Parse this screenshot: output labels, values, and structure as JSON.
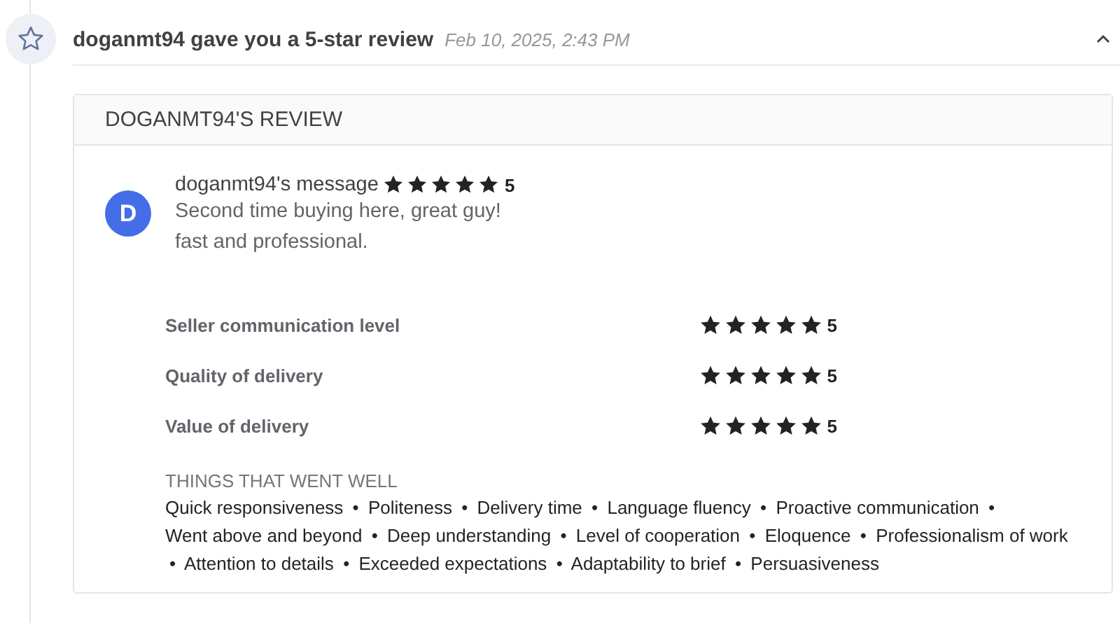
{
  "notification": {
    "title": "doganmt94 gave you a 5-star review",
    "date": "Feb 10, 2025, 2:43 PM",
    "expanded": true
  },
  "review": {
    "heading": "DOGANMT94'S REVIEW",
    "avatar_letter": "D",
    "author": "doganmt94's message",
    "stars": 5,
    "rating": "5",
    "message": [
      "Second time buying here, great guy!",
      "fast and professional."
    ],
    "ratings": [
      {
        "label": "Seller communication level",
        "stars": 5,
        "rating": "5"
      },
      {
        "label": "Quality of delivery",
        "stars": 5,
        "rating": "5"
      },
      {
        "label": "Value of delivery",
        "stars": 5,
        "rating": "5"
      }
    ],
    "things_heading": "THINGS THAT WENT WELL",
    "separator": "•",
    "things": [
      "Quick responsiveness",
      "Politeness",
      "Delivery time",
      "Language fluency",
      "Proactive communication",
      "Went above and beyond",
      "Deep understanding",
      "Level of cooperation",
      "Eloquence",
      "Professionalism of work",
      "Attention to details",
      "Exceeded expectations",
      "Adaptability to brief",
      "Persuasiveness"
    ]
  }
}
